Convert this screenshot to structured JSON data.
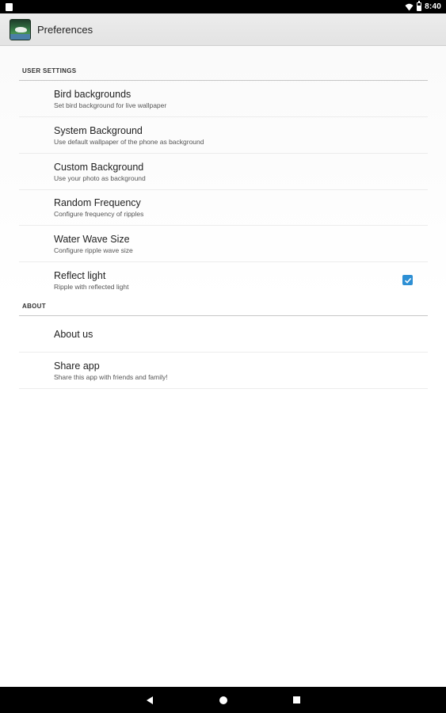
{
  "status_bar": {
    "time": "8:40",
    "icons": [
      "notification-icon",
      "wifi-icon",
      "battery-icon"
    ]
  },
  "action_bar": {
    "title": "Preferences",
    "app_icon": "bird-app-icon"
  },
  "user_settings": {
    "header": "USER SETTINGS",
    "items": [
      {
        "title": "Bird backgrounds",
        "summary": "Set bird background for live wallpaper"
      },
      {
        "title": "System Background",
        "summary": "Use default wallpaper of the phone as background"
      },
      {
        "title": "Custom Background",
        "summary": "Use your photo as background"
      },
      {
        "title": "Random Frequency",
        "summary": "Configure frequency of ripples"
      },
      {
        "title": "Water Wave Size",
        "summary": "Configure ripple wave size"
      },
      {
        "title": "Reflect light",
        "summary": "Ripple with reflected light",
        "checked": true
      }
    ]
  },
  "about": {
    "header": "ABOUT",
    "items": [
      {
        "title": "About us"
      },
      {
        "title": "Share app",
        "summary": "Share this app with friends and family!"
      }
    ]
  },
  "colors": {
    "checkbox": "#2d8fd4",
    "action_bar": "#e8e8e8",
    "status_bar": "#000000"
  }
}
